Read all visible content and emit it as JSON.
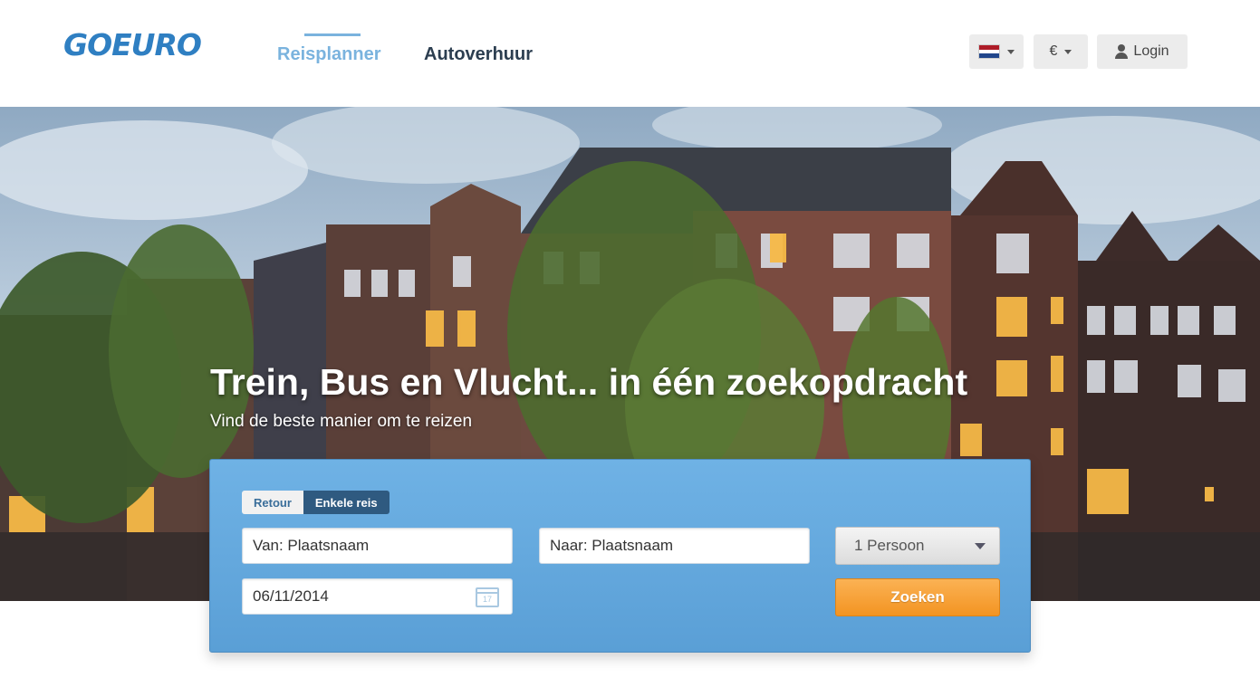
{
  "header": {
    "logo": "GOEURO",
    "nav": {
      "reisplanner": "Reisplanner",
      "autoverhuur": "Autoverhuur"
    },
    "currency": "€",
    "login": "Login",
    "flag_colors": [
      "#ae1c28",
      "#ffffff",
      "#21468b"
    ]
  },
  "hero": {
    "title": "Trein, Bus en Vlucht... in één zoekopdracht",
    "subtitle": "Vind de beste manier om te reizen"
  },
  "search": {
    "tabs": {
      "retour": "Retour",
      "enkele": "Enkele reis"
    },
    "van": "Van: Plaatsnaam",
    "naar": "Naar: Plaatsnaam",
    "date": "06/11/2014",
    "calendar_day": "17",
    "persoon": "1 Persoon",
    "zoeken": "Zoeken"
  },
  "colors": {
    "brand": "#2f7fc2",
    "accent": "#f39422",
    "panel": "#5a9fd6"
  }
}
